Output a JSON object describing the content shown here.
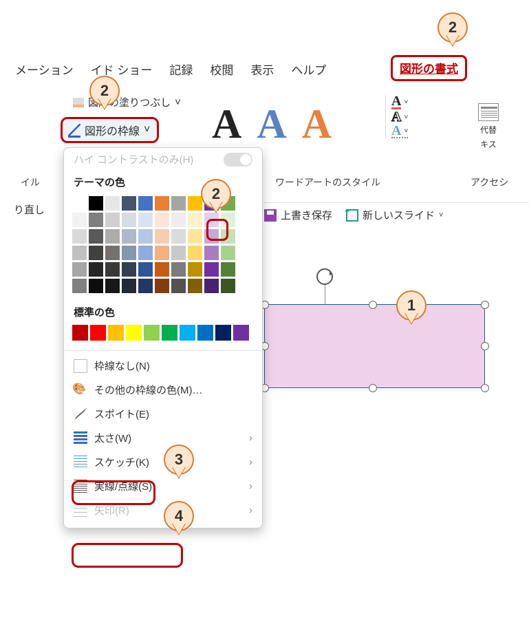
{
  "tabs": {
    "t1": "メーション",
    "t2": "イド ショー",
    "t3": "記録",
    "t4": "校閲",
    "t5": "表示",
    "t6": "ヘルプ",
    "shape_format": "図形の書式"
  },
  "ribbon": {
    "fill_label": "図形の塗りつぶし",
    "outline_label": "図形の枠線",
    "style_group_left": "イル",
    "style_group_center": "ワードアートのスタイル",
    "style_group_right": "アクセシ",
    "redo_label": "り直し",
    "alt_text_1": "代替",
    "alt_text_2": "キス",
    "save_label": "上書き保存",
    "new_slide_label": "新しいスライド"
  },
  "dropdown": {
    "high_contrast": "ハイ コントラストのみ(H)",
    "theme_colors": "テーマの色",
    "standard_colors": "標準の色",
    "no_outline": "枠線なし(N)",
    "more_colors": "その他の枠線の色(M)…",
    "eyedropper": "スポイト(E)",
    "weight": "太さ(W)",
    "sketch": "スケッチ(K)",
    "dashes": "実線/点線(S)",
    "arrows": "矢印(R)"
  },
  "palette": {
    "theme": [
      [
        "#ffffff",
        "#000000",
        "#e7e6e6",
        "#44546a",
        "#4472c4",
        "#ed7d31",
        "#a5a5a5",
        "#ffc000",
        "#7030a0",
        "#70ad47"
      ],
      [
        "#f2f2f2",
        "#7f7f7f",
        "#d0cece",
        "#d6dce5",
        "#d9e2f3",
        "#fbe5d6",
        "#ededed",
        "#fff2cc",
        "#e2d0ec",
        "#e2f0d9"
      ],
      [
        "#d9d9d9",
        "#595959",
        "#aeabab",
        "#adb9ca",
        "#b4c7e7",
        "#f8cbad",
        "#dbdbdb",
        "#ffe699",
        "#c5a9d7",
        "#c5e0b4"
      ],
      [
        "#bfbfbf",
        "#404040",
        "#757171",
        "#8497b0",
        "#8faadc",
        "#f4b183",
        "#c9c9c9",
        "#ffd966",
        "#a87cc2",
        "#a9d18e"
      ],
      [
        "#a6a6a6",
        "#262626",
        "#3b3838",
        "#333f50",
        "#2e5597",
        "#c55a11",
        "#7b7b7b",
        "#bf9000",
        "#7030a0",
        "#548235"
      ],
      [
        "#808080",
        "#0d0d0d",
        "#171717",
        "#222a35",
        "#1f3864",
        "#843c0c",
        "#525252",
        "#806000",
        "#4b206e",
        "#385723"
      ]
    ],
    "standard": [
      "#c00000",
      "#ff0000",
      "#ffc000",
      "#ffff00",
      "#92d050",
      "#00b050",
      "#00b0f0",
      "#0070c0",
      "#002060",
      "#7030a0"
    ]
  },
  "callouts": {
    "c1": "1",
    "c2": "2",
    "c3": "3",
    "c4": "4"
  }
}
